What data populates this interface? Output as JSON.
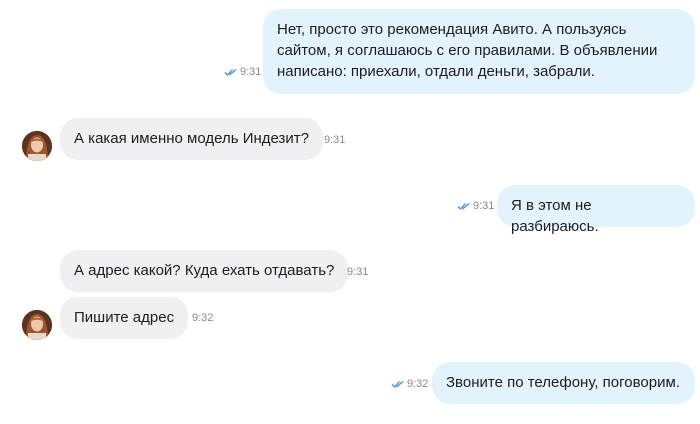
{
  "messages": [
    {
      "text": "Нет, просто это рекомендация Авито. А пользуясь\nсайтом, я соглашаюсь с его правилами. В объявлении\nнаписано: приехали, отдали деньги, забрали.",
      "time": "9:31",
      "direction": "out",
      "read": true
    },
    {
      "text": "А какая именно модель Индезит?",
      "time": "9:31",
      "direction": "in"
    },
    {
      "text": "Я в этом не разбираюсь.",
      "time": "9:31",
      "direction": "out",
      "read": true
    },
    {
      "text": "А адрес какой? Куда ехать отдавать?",
      "time": "9:31",
      "direction": "in"
    },
    {
      "text": "Пишите адрес",
      "time": "9:32",
      "direction": "in"
    },
    {
      "text": "Звоните по телефону, поговорим.",
      "time": "9:32",
      "direction": "out",
      "read": true
    }
  ],
  "colors": {
    "outgoing_bubble": "#e3f3fe",
    "incoming_bubble": "#f0f0f2",
    "read_ticks": "#3d8fe0",
    "timestamp": "#8a8a8e"
  },
  "icons": {
    "read_status": "double-check-icon",
    "avatar": "contact-avatar"
  }
}
